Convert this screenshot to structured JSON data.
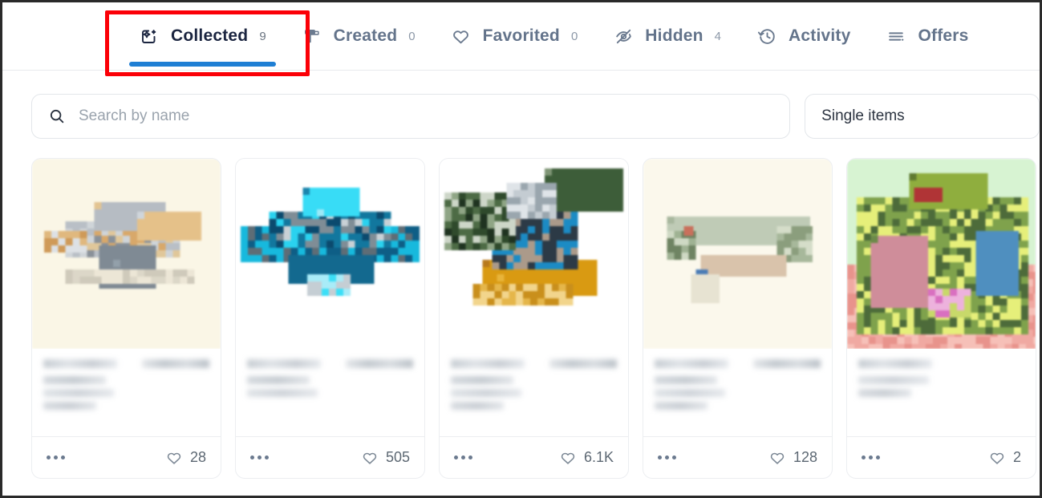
{
  "tabs": [
    {
      "id": "collected",
      "label": "Collected",
      "count": "9",
      "icon": "collected-sparkle-icon",
      "active": true
    },
    {
      "id": "created",
      "label": "Created",
      "count": "0",
      "icon": "paint-roller-icon",
      "active": false
    },
    {
      "id": "favorited",
      "label": "Favorited",
      "count": "0",
      "icon": "heart-icon",
      "active": false
    },
    {
      "id": "hidden",
      "label": "Hidden",
      "count": "4",
      "icon": "eye-off-icon",
      "active": false
    },
    {
      "id": "activity",
      "label": "Activity",
      "count": "",
      "icon": "history-clock-icon",
      "active": false
    },
    {
      "id": "offers",
      "label": "Offers",
      "count": "",
      "icon": "list-lines-icon",
      "active": false
    }
  ],
  "filters": {
    "search": {
      "value": "",
      "placeholder": "Search by name",
      "icon": "search-icon"
    },
    "item_type": {
      "selected": "Single items"
    }
  },
  "cards": [
    {
      "name": "item-card-1",
      "likes": "28",
      "bg": "#faf6e6"
    },
    {
      "name": "item-card-2",
      "likes": "505",
      "bg": "#ffffff"
    },
    {
      "name": "item-card-3",
      "likes": "6.1K",
      "bg": "#ffffff"
    },
    {
      "name": "item-card-4",
      "likes": "128",
      "bg": "#fbf8ec"
    },
    {
      "name": "item-card-5",
      "likes": "2",
      "bg": "#d7f3d2"
    }
  ],
  "colors": {
    "active_tab_text": "#1b2540",
    "inactive_tab_text": "#64748b",
    "tab_underline": "#1f7fd4",
    "annotation_box": "#fb0007",
    "page_border": "#2a2a2a"
  },
  "annotation": {
    "target_tab": "collected",
    "shape": "rectangle",
    "color": "#fb0007"
  }
}
